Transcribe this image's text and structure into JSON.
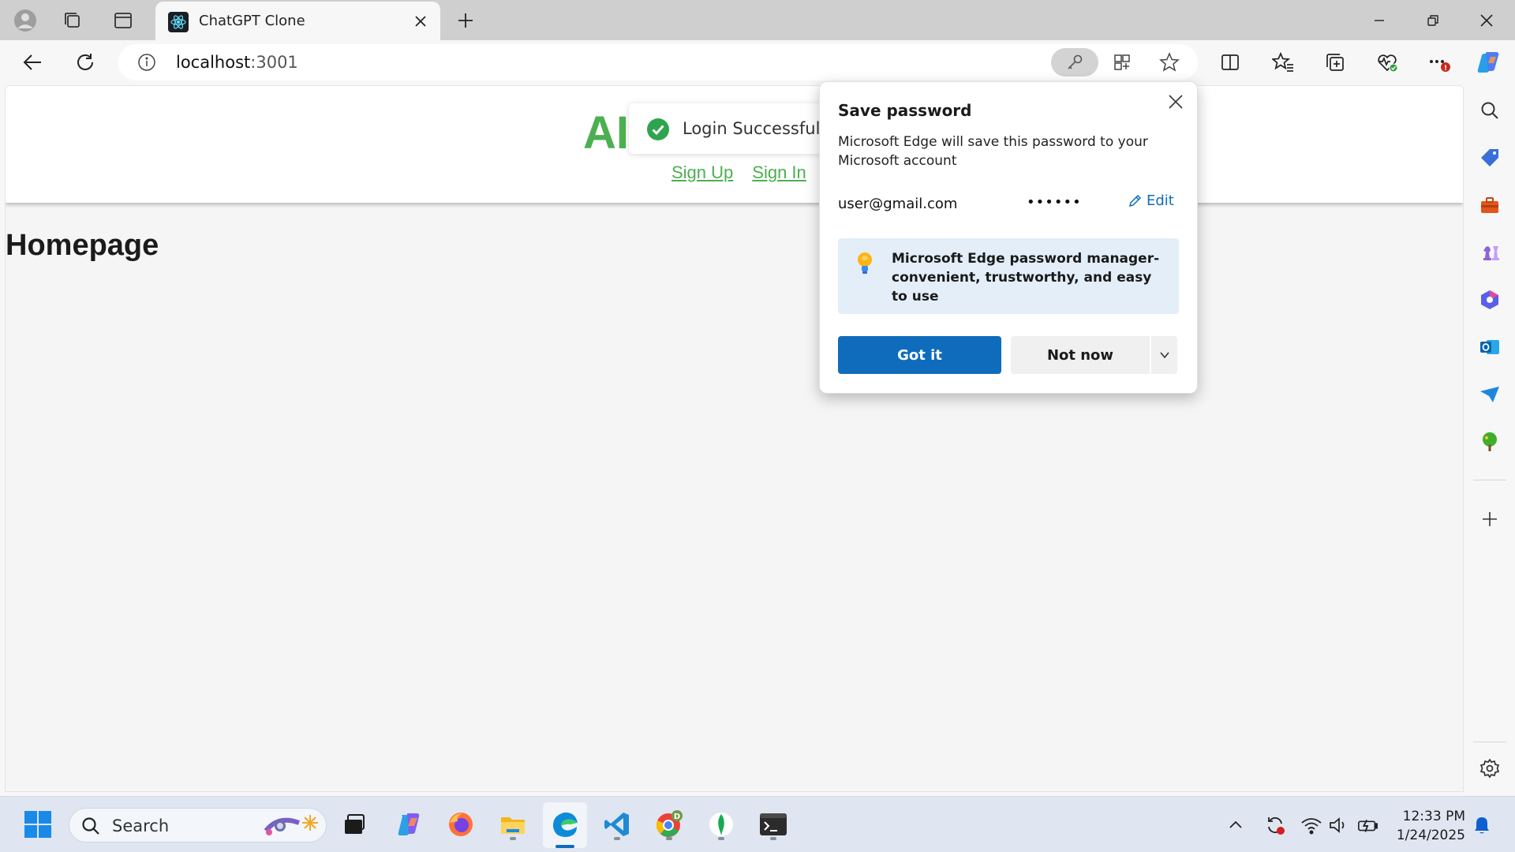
{
  "browser": {
    "tab_title": "ChatGPT Clone",
    "url_host": "localhost",
    "url_port": ":3001"
  },
  "site": {
    "logo": "AI",
    "nav": {
      "signup": "Sign Up",
      "signin": "Sign In"
    },
    "heading": "Homepage",
    "toast": "Login Successfully"
  },
  "password_popup": {
    "title": "Save password",
    "description": "Microsoft Edge will save this password to your Microsoft account",
    "username": "user@gmail.com",
    "password_mask": "••••••",
    "edit_label": "Edit",
    "tip": "Microsoft Edge password manager- convenient, trustworthy, and easy to use",
    "got_it": "Got it",
    "not_now": "Not now"
  },
  "taskbar": {
    "search_placeholder": "Search",
    "time": "12:33 PM",
    "date": "1/24/2025"
  },
  "colors": {
    "accent_blue": "#0f6cbd",
    "site_green": "#4caf50",
    "toast_green": "#2ea44f"
  }
}
